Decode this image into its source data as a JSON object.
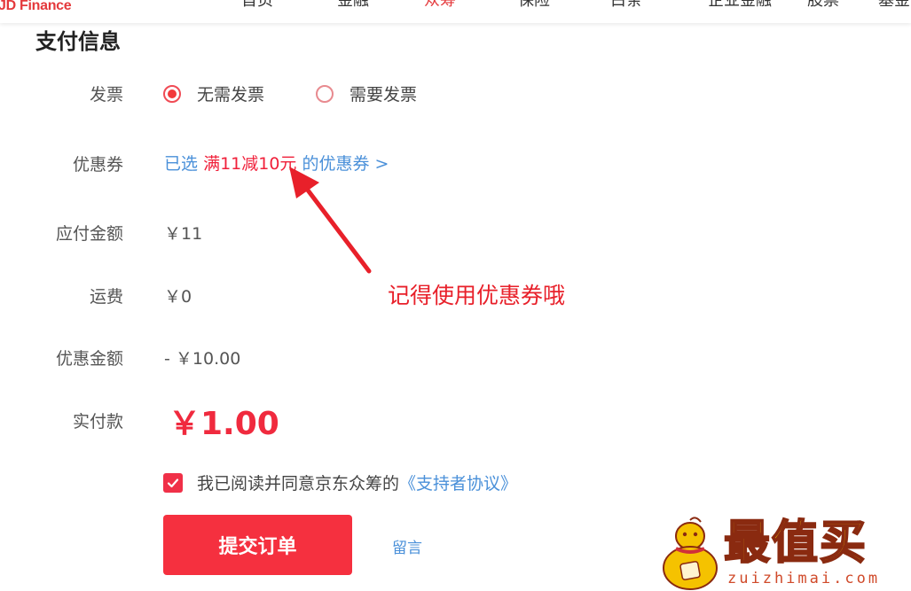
{
  "header": {
    "brand": "JD Finance",
    "nav": [
      "首页",
      "金融",
      "众筹",
      "保险",
      "白条",
      "企业金融",
      "股票",
      "基金"
    ]
  },
  "payment": {
    "title": "支付信息",
    "invoice": {
      "label": "发票",
      "options": [
        "无需发票",
        "需要发票"
      ],
      "selected": "无需发票"
    },
    "coupon": {
      "label": "优惠券",
      "prefix": "已选",
      "coupon_name": "满11减10元",
      "suffix": "的优惠券 >"
    },
    "payable": {
      "label": "应付金额",
      "value": "￥11"
    },
    "shipping": {
      "label": "运费",
      "value": "￥0"
    },
    "discount": {
      "label": "优惠金额",
      "value": "- ￥10.00"
    },
    "actual": {
      "label": "实付款",
      "value": "￥1.00"
    },
    "agreement": {
      "text": "我已阅读并同意京东众筹的",
      "link": "《支持者协议》",
      "checked": true
    },
    "submit_label": "提交订单",
    "message_label": "留言"
  },
  "annotation": {
    "text": "记得使用优惠券哦",
    "color": "#e8202a"
  },
  "watermark": {
    "title": "最值买",
    "subtitle": "zuizhimai.com"
  },
  "colors": {
    "accent_red": "#f5303f",
    "link_blue": "#4a90d9"
  }
}
